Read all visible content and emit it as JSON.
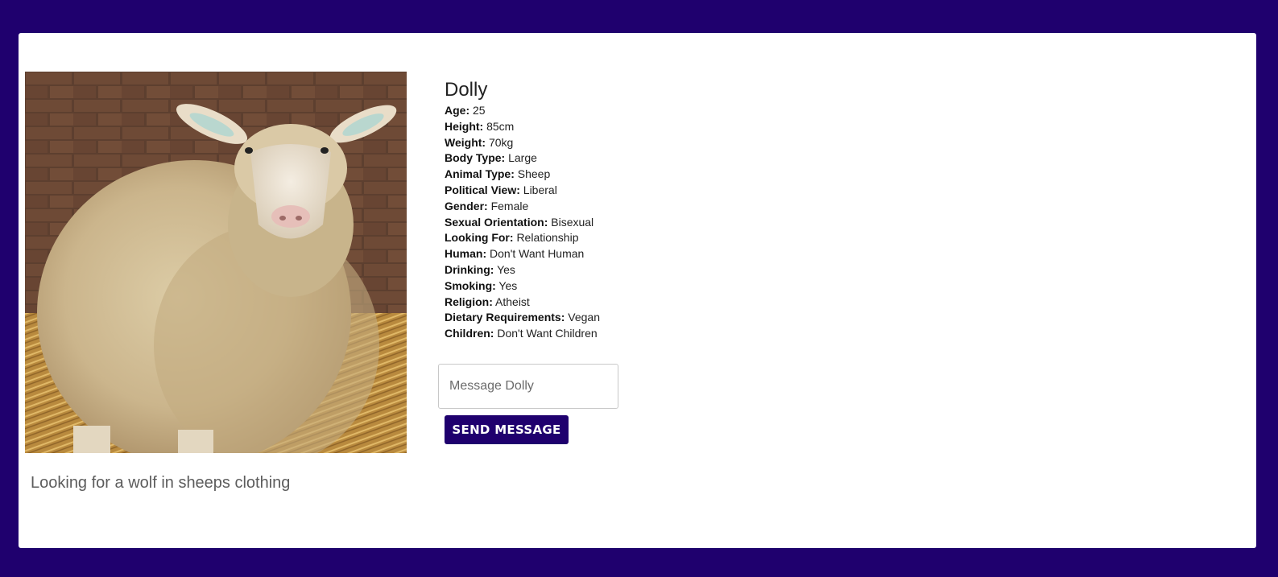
{
  "profile": {
    "name": "Dolly",
    "bio": "Looking for a wolf in sheeps clothing",
    "photo_icon": "sheep-photo",
    "attributes": [
      {
        "label": "Age:",
        "value": "25"
      },
      {
        "label": "Height:",
        "value": "85cm"
      },
      {
        "label": "Weight:",
        "value": "70kg"
      },
      {
        "label": "Body Type:",
        "value": "Large"
      },
      {
        "label": "Animal Type:",
        "value": "Sheep"
      },
      {
        "label": "Political View:",
        "value": "Liberal"
      },
      {
        "label": "Gender:",
        "value": "Female"
      },
      {
        "label": "Sexual Orientation:",
        "value": "Bisexual"
      },
      {
        "label": "Looking For:",
        "value": "Relationship"
      },
      {
        "label": "Human:",
        "value": "Don't Want Human"
      },
      {
        "label": "Drinking:",
        "value": "Yes"
      },
      {
        "label": "Smoking:",
        "value": "Yes"
      },
      {
        "label": "Religion:",
        "value": "Atheist"
      },
      {
        "label": "Dietary Requirements:",
        "value": "Vegan"
      },
      {
        "label": "Children:",
        "value": "Don't Want Children"
      }
    ]
  },
  "message": {
    "placeholder": "Message Dolly",
    "value": "",
    "send_label": "SEND MESSAGE"
  },
  "colors": {
    "background": "#1f006e",
    "card": "#ffffff",
    "button": "#1f006e"
  }
}
